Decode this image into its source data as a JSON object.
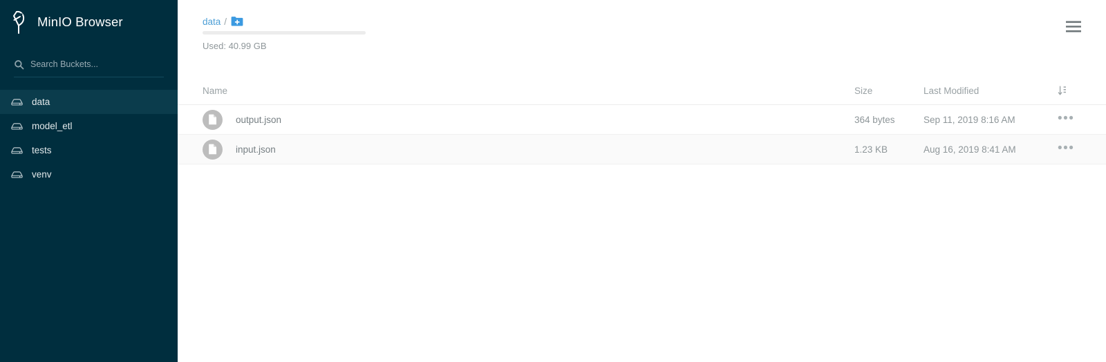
{
  "app": {
    "title": "MinIO Browser",
    "logo_icon": "minio-flamingo-logo"
  },
  "sidebar": {
    "search": {
      "icon": "search-icon",
      "placeholder": "Search Buckets...",
      "value": ""
    },
    "buckets": [
      {
        "label": "data",
        "icon": "bucket-icon",
        "active": true
      },
      {
        "label": "model_etl",
        "icon": "bucket-icon",
        "active": false
      },
      {
        "label": "tests",
        "icon": "bucket-icon",
        "active": false
      },
      {
        "label": "venv",
        "icon": "bucket-icon",
        "active": false
      }
    ]
  },
  "topbar": {
    "breadcrumb": {
      "bucket": "data",
      "separator": "/",
      "new_folder_icon": "folder-plus-icon"
    },
    "storage": {
      "used_label": "Used: 40.99 GB",
      "percent": 0,
      "bar_color": "#4d9fd6",
      "track_color": "#ececec"
    },
    "menu_icon": "hamburger-menu-icon"
  },
  "table": {
    "columns": {
      "name": "Name",
      "size": "Size",
      "modified": "Last Modified",
      "sort_icon": "sort-arrows-icon"
    },
    "rows": [
      {
        "icon": "document-icon",
        "name": "output.json",
        "size": "364 bytes",
        "modified": "Sep 11, 2019 8:16 AM",
        "actions": "•••"
      },
      {
        "icon": "document-icon",
        "name": "input.json",
        "size": "1.23 KB",
        "modified": "Aug 16, 2019 8:41 AM",
        "actions": "•••"
      }
    ]
  },
  "colors": {
    "sidebar_bg": "#002e3e",
    "sidebar_active": "#0b3c4c",
    "accent_blue": "#4d9fd6",
    "text_muted": "#8e9699",
    "row_alt": "#fafafa"
  }
}
